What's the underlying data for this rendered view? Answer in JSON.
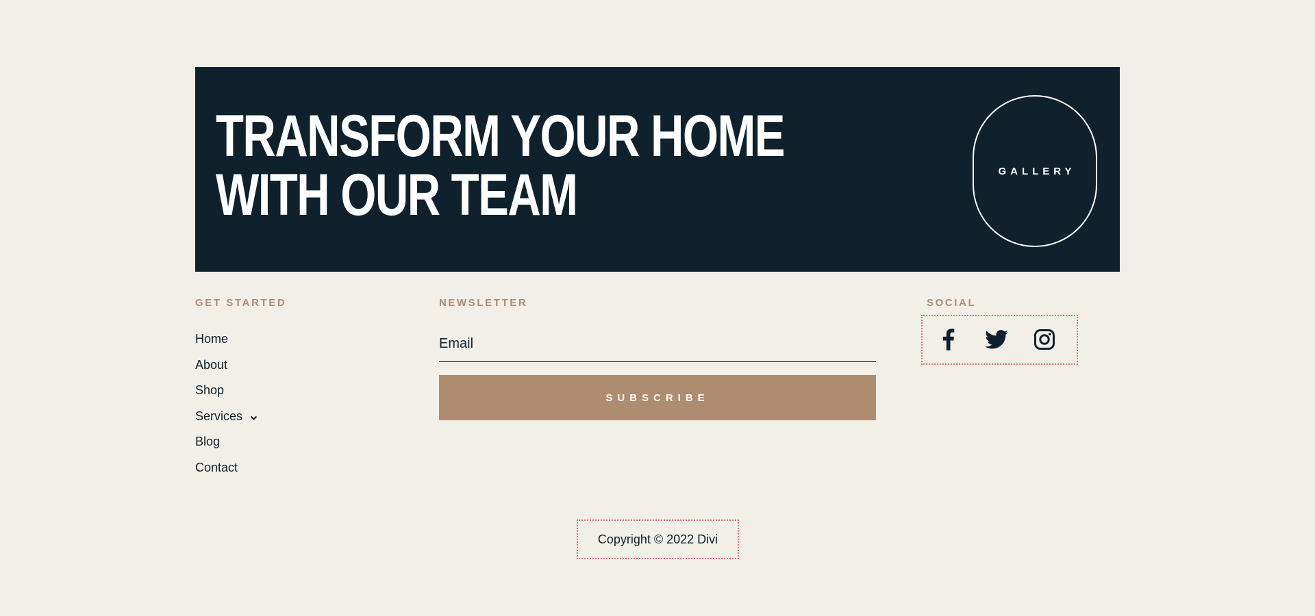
{
  "hero": {
    "title_line1": "Transform your home",
    "title_line2": "with our team",
    "gallery_label": "GALLERY"
  },
  "colors": {
    "background": "#f2efe9",
    "dark": "#0e212d",
    "accent": "#ad8c70",
    "highlight_border": "#e86b6b"
  },
  "footer": {
    "get_started": {
      "heading": "GET STARTED",
      "links": [
        {
          "label": "Home"
        },
        {
          "label": "About"
        },
        {
          "label": "Shop"
        },
        {
          "label": "Services",
          "has_dropdown": true,
          "icon": "chevron-down-icon"
        },
        {
          "label": "Blog"
        },
        {
          "label": "Contact"
        }
      ]
    },
    "newsletter": {
      "heading": "NEWSLETTER",
      "email_placeholder": "Email",
      "email_value": "",
      "subscribe_label": "SUBSCRIBE"
    },
    "social": {
      "heading": "SOCIAL",
      "icons": [
        "facebook-icon",
        "twitter-icon",
        "instagram-icon"
      ]
    },
    "copyright": "Copyright © 2022 Divi"
  }
}
